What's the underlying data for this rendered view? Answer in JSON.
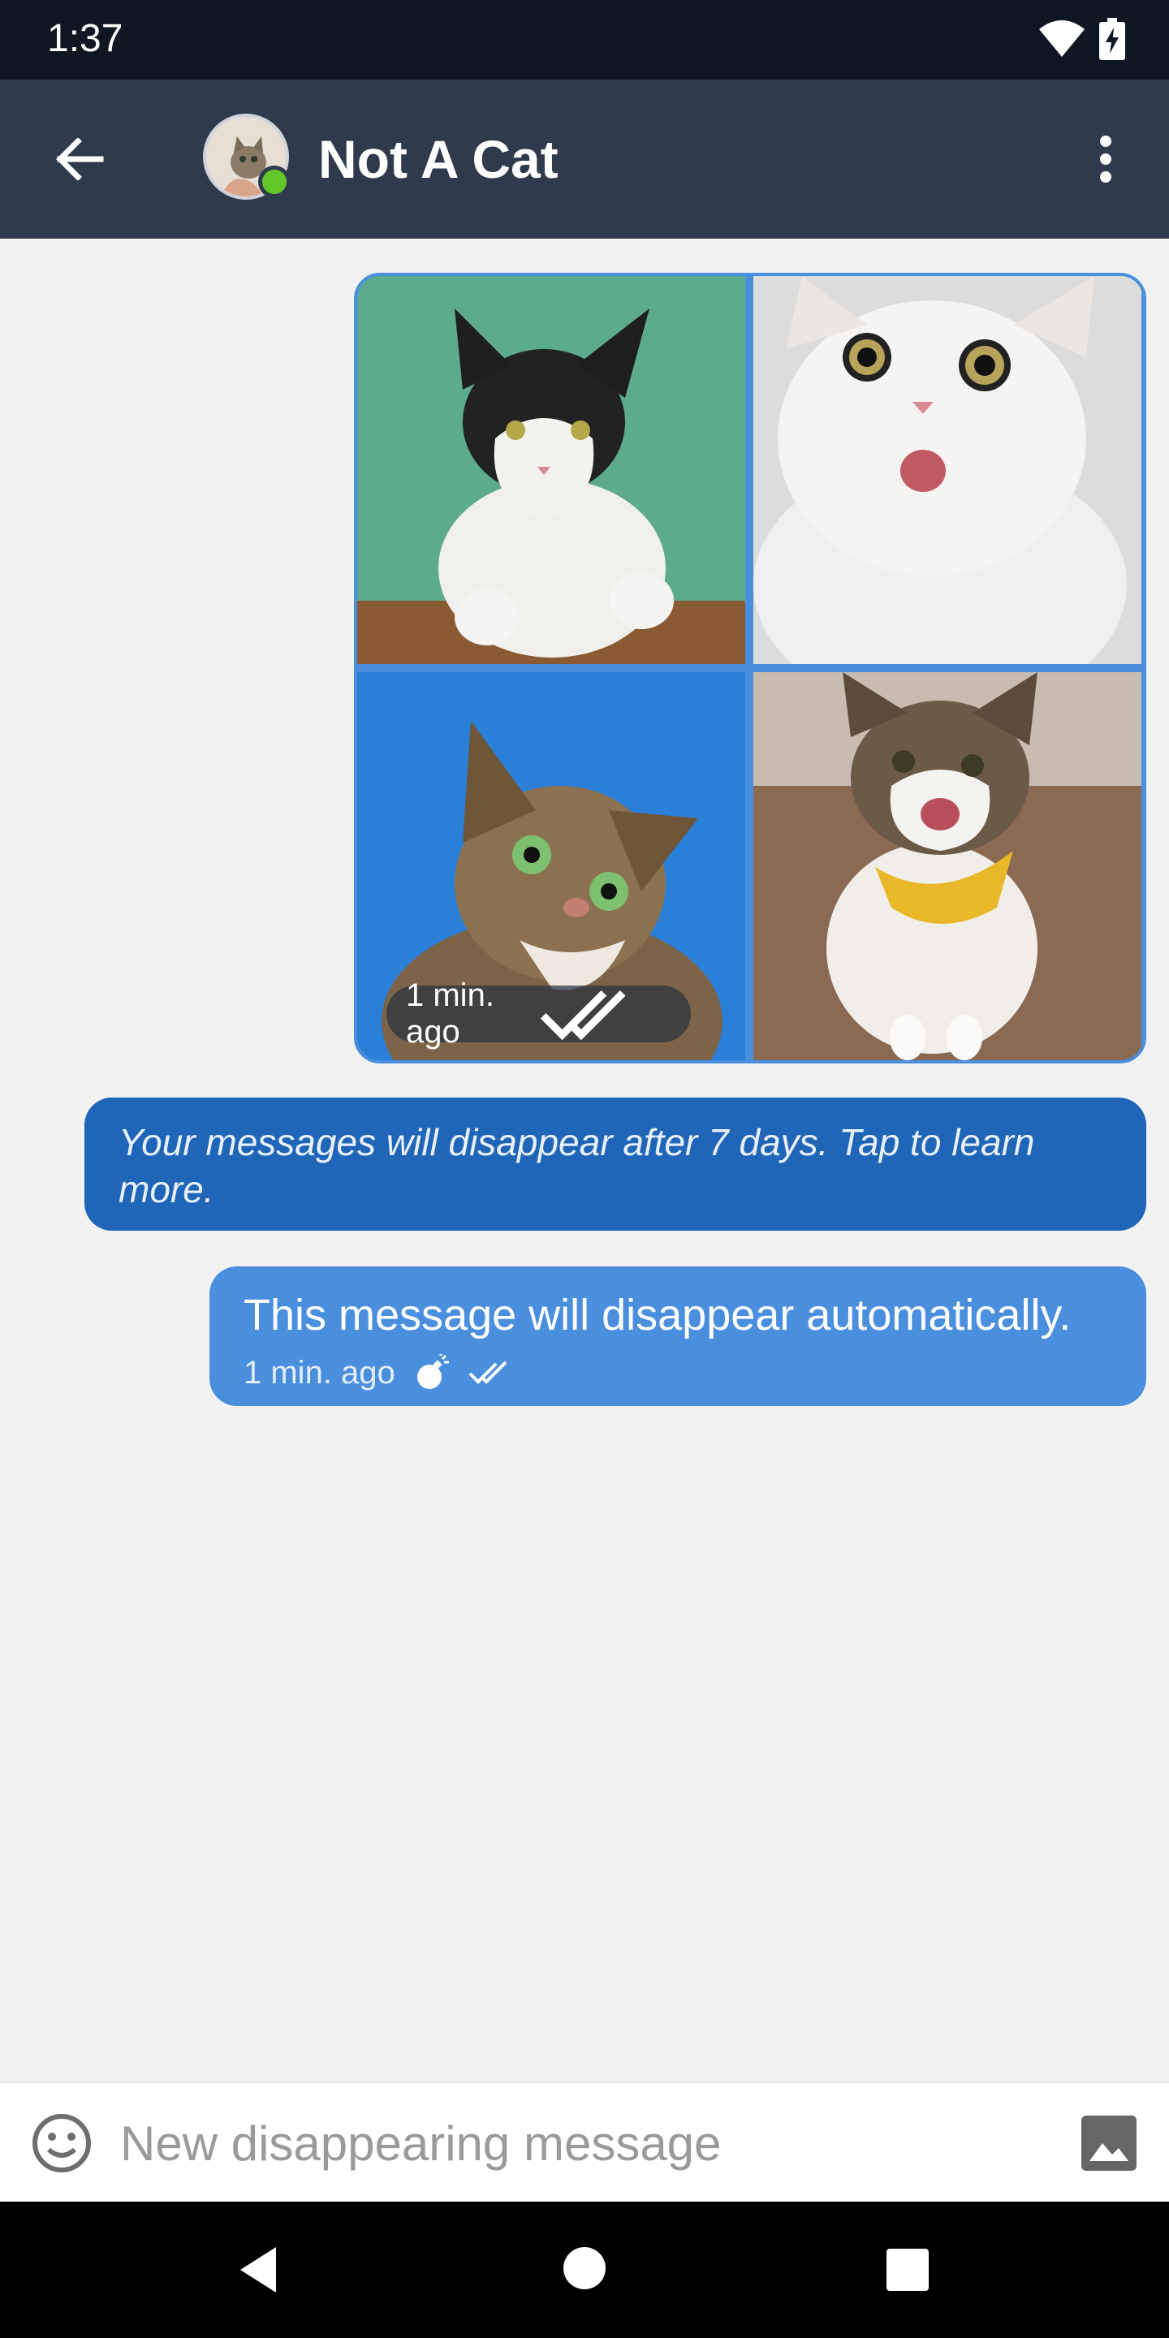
{
  "status_bar": {
    "time": "1:37",
    "icons": [
      "wifi-icon",
      "battery-charging-icon"
    ]
  },
  "app_bar": {
    "contact_name": "Not A Cat",
    "back_icon": "arrow-back-icon",
    "menu_icon": "more-vert-icon",
    "online_status_color": "#63c72a",
    "background_color": "#2f3b4c"
  },
  "messages": {
    "photo_message": {
      "photo_count": 4,
      "photos": [
        "cat-black-white-on-green",
        "white-cat-surprised",
        "tabby-cat-on-blue",
        "cat-yellow-bandana-on-floor"
      ],
      "timestamp": "1 min. ago",
      "status_icon": "double-check-icon"
    },
    "disappearing_notice": {
      "text": "Your messages will disappear after 7 days. Tap to learn more.",
      "color": "#1f65b8"
    },
    "text_message": {
      "text": "This message will disappear automatically.",
      "timestamp": "1 min. ago",
      "timer_icon": "bomb-icon",
      "status_icon": "double-check-icon",
      "color": "#4a8ede"
    }
  },
  "compose": {
    "placeholder": "New disappearing message",
    "value": "",
    "emoji_icon": "emoji-icon",
    "attach_icon": "image-icon"
  },
  "nav_bar": {
    "buttons": [
      "nav-back-icon",
      "nav-home-icon",
      "nav-recents-icon"
    ]
  }
}
